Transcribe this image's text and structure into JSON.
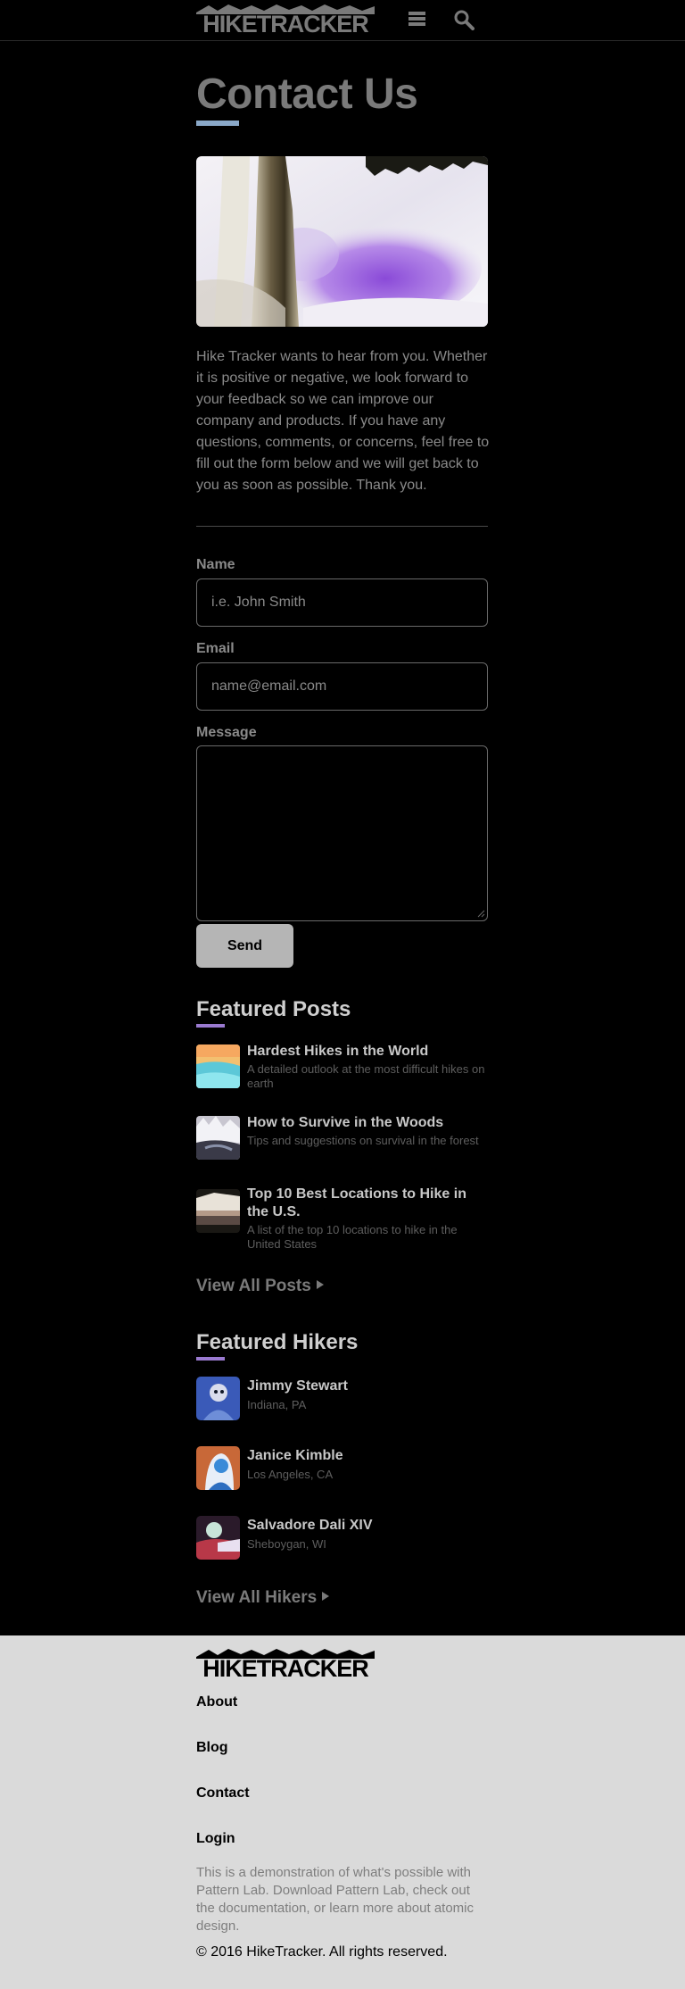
{
  "header": {
    "logo_text": "HIKETRACKER",
    "menu_icon": "hamburger-menu-icon",
    "search_icon": "search-icon"
  },
  "page": {
    "title": "Contact Us",
    "accent_color": "#8aa8c8",
    "intro": "Hike Tracker wants to hear from you. Whether it is positive or negative, we look forward to your feedback so we can improve our company and products. If you have any questions, comments, or concerns, feel free to fill out the form below and we will get back to you as soon as possible. Thank you."
  },
  "form": {
    "name_label": "Name",
    "name_placeholder": "i.e. John Smith",
    "email_label": "Email",
    "email_placeholder": "name@email.com",
    "message_label": "Message",
    "send_label": "Send"
  },
  "featured_posts": {
    "title": "Featured Posts",
    "accent_color": "#9a7ad0",
    "items": [
      {
        "title": "Hardest Hikes in the World",
        "description": "A detailed outlook at the most difficult hikes on earth"
      },
      {
        "title": "How to Survive in the Woods",
        "description": "Tips and suggestions on survival in the forest"
      },
      {
        "title": "Top 10 Best Locations to Hike in the U.S.",
        "description": "A list of the top 10 locations to hike in the United States"
      }
    ],
    "view_all": "View All Posts"
  },
  "featured_hikers": {
    "title": "Featured Hikers",
    "items": [
      {
        "name": "Jimmy Stewart",
        "location": "Indiana, PA"
      },
      {
        "name": "Janice Kimble",
        "location": "Los Angeles, CA"
      },
      {
        "name": "Salvadore Dali XIV",
        "location": "Sheboygan, WI"
      }
    ],
    "view_all": "View All Hikers"
  },
  "footer": {
    "logo_text": "HIKETRACKER",
    "links": [
      "About",
      "Blog",
      "Contact",
      "Login"
    ],
    "blurb": "This is a demonstration of what's possible with Pattern Lab. Download Pattern Lab, check out the documentation, or learn more about atomic design.",
    "copyright": "© 2016 HikeTracker. All rights reserved."
  }
}
